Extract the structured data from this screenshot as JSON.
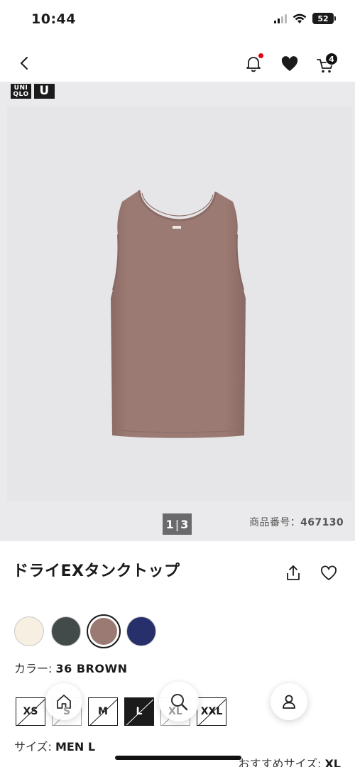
{
  "status_bar": {
    "time": "10:44",
    "battery": "52"
  },
  "nav": {
    "cart_count": "4"
  },
  "brand": {
    "logo_top": "UNI",
    "logo_bottom": "QLO",
    "logo_u": "U"
  },
  "gallery": {
    "page_current": "1",
    "page_total": "3",
    "sku_label": "商品番号：",
    "sku_value": "467130"
  },
  "product": {
    "title": "ドライEXタンクトップ"
  },
  "colors": {
    "label": "カラー: ",
    "selected_value": "36 BROWN",
    "swatches": [
      {
        "name": "off-white",
        "hex": "#f6efe2"
      },
      {
        "name": "dark-gray",
        "hex": "#434a4a"
      },
      {
        "name": "brown",
        "hex": "#9c7a74"
      },
      {
        "name": "navy",
        "hex": "#27306a"
      }
    ]
  },
  "sizes": {
    "label": "サイズ: ",
    "selected_value": "MEN L",
    "items": [
      "XS",
      "S",
      "M",
      "L",
      "XL",
      "XXL"
    ],
    "recommend_label": "おすすめサイズ: ",
    "recommend_value": "XL"
  },
  "bottom_nav": {
    "icons": [
      "home-icon",
      "search-icon",
      "account-icon"
    ]
  }
}
